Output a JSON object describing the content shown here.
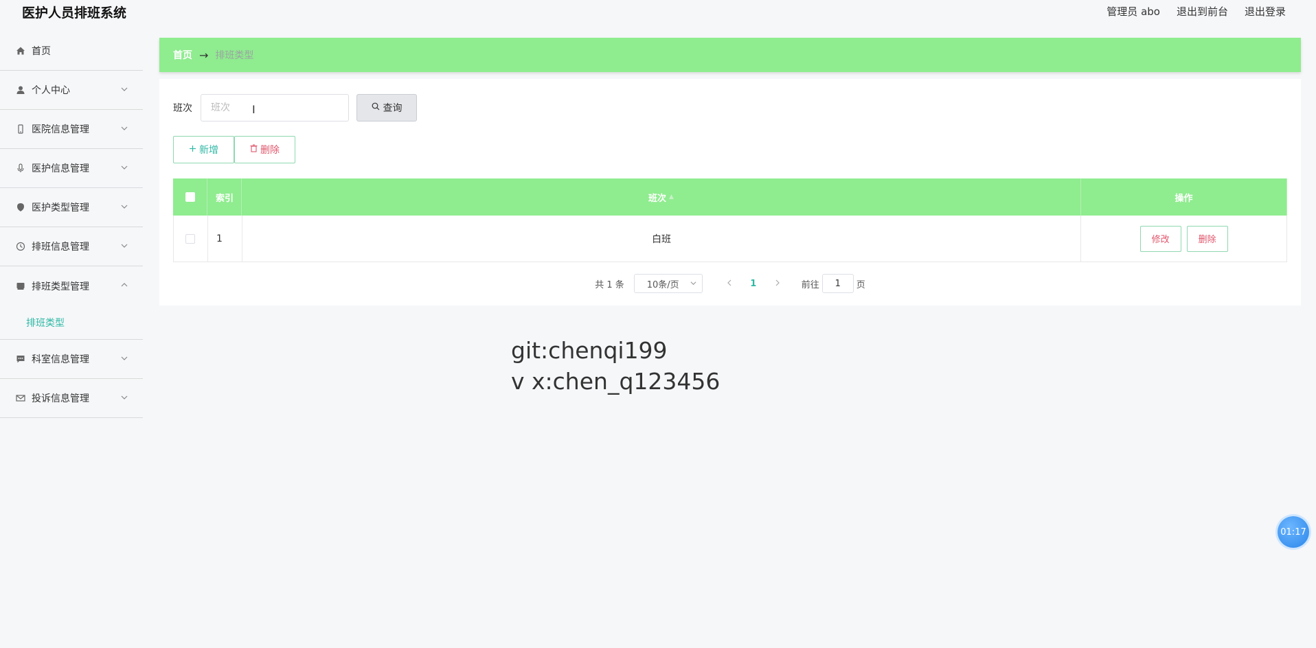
{
  "header": {
    "title": "医护人员排班系统",
    "admin_label": "管理员 abo",
    "to_front_label": "退出到前台",
    "logout_label": "退出登录"
  },
  "sidebar": {
    "items": [
      {
        "label": "首页",
        "icon": "home-icon"
      },
      {
        "label": "个人中心",
        "icon": "user-icon"
      },
      {
        "label": "医院信息管理",
        "icon": "phone-icon"
      },
      {
        "label": "医护信息管理",
        "icon": "microphone-icon"
      },
      {
        "label": "医护类型管理",
        "icon": "pin-icon"
      },
      {
        "label": "排班信息管理",
        "icon": "clock-icon"
      },
      {
        "label": "排班类型管理",
        "icon": "bed-icon"
      },
      {
        "label": "科室信息管理",
        "icon": "chat-icon"
      },
      {
        "label": "投诉信息管理",
        "icon": "mail-icon"
      }
    ],
    "sub_item": "排班类型"
  },
  "breadcrumb": {
    "home": "首页",
    "arrow": "→",
    "current": "排班类型"
  },
  "search": {
    "label": "班次",
    "placeholder": "班次",
    "button_label": "查询"
  },
  "actions": {
    "add_label": "新增",
    "delete_label": "删除"
  },
  "table": {
    "headers": {
      "index": "索引",
      "shift": "班次",
      "ops": "操作"
    },
    "rows": [
      {
        "index": "1",
        "shift": "白班",
        "edit": "修改",
        "delete": "删除"
      }
    ]
  },
  "pagination": {
    "total": "共 1 条",
    "page_size": "10条/页",
    "current_page": "1",
    "goto_label": "前往",
    "goto_value": "1",
    "page_suffix": "页"
  },
  "watermark": {
    "line1": "git:chenqi199",
    "line2": "v x:chen_q123456"
  },
  "timer": "01:17",
  "colors": {
    "accent_green": "#8fec8f",
    "teal": "#2fb8a5",
    "danger": "#e0566b"
  }
}
